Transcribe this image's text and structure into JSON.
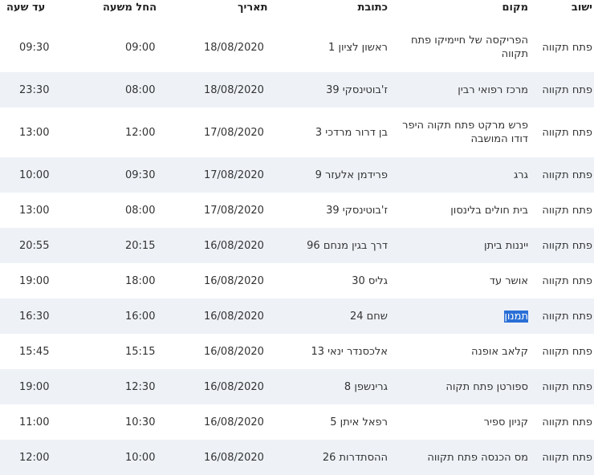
{
  "headers": {
    "city": "ישוב",
    "place": "מקום",
    "address": "כתובת",
    "date": "תאריך",
    "start": "החל משעה",
    "end": "עד שעה"
  },
  "rows": [
    {
      "city": "פתח תקווה",
      "place": "הפריקסה של חיימיקו פתח תקווה",
      "address": "ראשון לציון 1",
      "date": "18/08/2020",
      "start": "09:00",
      "end": "09:30"
    },
    {
      "city": "פתח תקווה",
      "place": "מרכז רפואי רבין",
      "address": "ז'בוטינסקי 39",
      "date": "18/08/2020",
      "start": "08:00",
      "end": "23:30"
    },
    {
      "city": "פתח תקווה",
      "place": "פרש מרקט פתח תקוה היפר דודו המושבה",
      "address": "בן דרור מרדכי 3",
      "date": "17/08/2020",
      "start": "12:00",
      "end": "13:00"
    },
    {
      "city": "פתח תקווה",
      "place": "גרג",
      "address": "פרידמן אלעזר 9",
      "date": "17/08/2020",
      "start": "09:30",
      "end": "10:00"
    },
    {
      "city": "פתח תקווה",
      "place": "בית חולים בלינסון",
      "address": "ז'בוטינסקי 39",
      "date": "17/08/2020",
      "start": "08:00",
      "end": "13:00"
    },
    {
      "city": "פתח תקווה",
      "place": "ייננות ביתן",
      "address": "דרך בגין מנחם 96",
      "date": "16/08/2020",
      "start": "20:15",
      "end": "20:55"
    },
    {
      "city": "פתח תקווה",
      "place": "אושר עד",
      "address": "גליס 30",
      "date": "16/08/2020",
      "start": "18:00",
      "end": "19:00"
    },
    {
      "city": "פתח תקווה",
      "place": "תמנון",
      "address": "שחם 24",
      "date": "16/08/2020",
      "start": "16:00",
      "end": "16:30",
      "highlighted": true
    },
    {
      "city": "פתח תקווה",
      "place": "קלאב אופנה",
      "address": "אלכסנדר ינאי 13",
      "date": "16/08/2020",
      "start": "15:15",
      "end": "15:45"
    },
    {
      "city": "פתח תקווה",
      "place": "ספורטן פתח תקוה",
      "address": "גרינשפן 8",
      "date": "16/08/2020",
      "start": "12:30",
      "end": "19:00"
    },
    {
      "city": "פתח תקווה",
      "place": "קניון ספיר",
      "address": "רפאל איתן 5",
      "date": "16/08/2020",
      "start": "10:30",
      "end": "11:00"
    },
    {
      "city": "פתח תקווה",
      "place": "מס הכנסה פתח תקווה",
      "address": "ההסתדרות 26",
      "date": "16/08/2020",
      "start": "10:00",
      "end": "12:00"
    }
  ]
}
